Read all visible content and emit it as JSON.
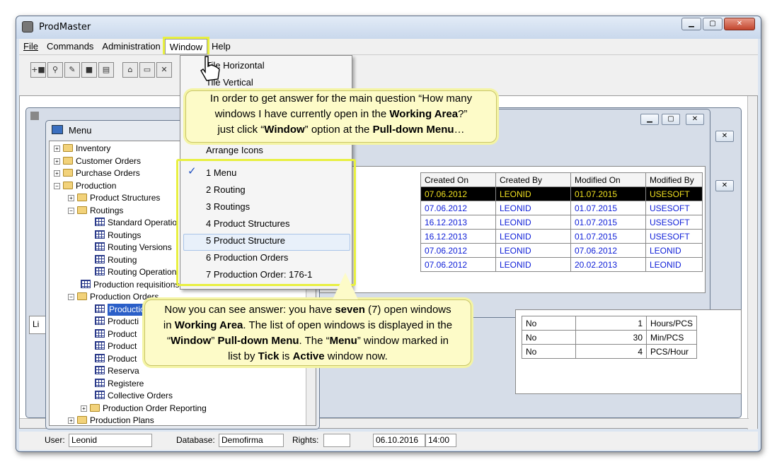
{
  "app": {
    "title": "ProdMaster"
  },
  "menubar": {
    "file": "File",
    "commands": "Commands",
    "administration": "Administration",
    "window": "Window",
    "help": "Help"
  },
  "window_menu": {
    "tile_horizontal": "Tile Horizontal",
    "tile_vertical": "Tile Vertical",
    "arrange_icons": "Arrange Icons",
    "windows": [
      "1 Menu",
      "2 Routing",
      "3 Routings",
      "4 Product Structures",
      "5 Product Structure",
      "6 Production Orders",
      "7 Production Order: 176-1"
    ],
    "active_index": 0,
    "check": "✓"
  },
  "menu_window": {
    "title": "Menu",
    "tree": [
      "Inventory",
      "Customer Orders",
      "Purchase Orders",
      "Production",
      "Product Structures",
      "Routings",
      "Standard Operatio",
      "Routings",
      "Routing Versions",
      "Routing",
      "Routing Operation",
      "Production requisitions",
      "Production Orders",
      "Production Orders List",
      "Producti",
      "Product",
      "Product",
      "Product",
      "Reserva",
      "Registere",
      "Collective Orders",
      "Production Order Reporting",
      "Production Plans"
    ]
  },
  "grid1": {
    "headers": [
      "Created On",
      "Created By",
      "Modified On",
      "Modified By"
    ],
    "rows": [
      [
        "07.06.2012",
        "LEONID",
        "01.07.2015",
        "USESOFT"
      ],
      [
        "07.06.2012",
        "LEONID",
        "01.07.2015",
        "USESOFT"
      ],
      [
        "16.12.2013",
        "LEONID",
        "01.07.2015",
        "USESOFT"
      ],
      [
        "16.12.2013",
        "LEONID",
        "01.07.2015",
        "USESOFT"
      ],
      [
        "07.06.2012",
        "LEONID",
        "07.06.2012",
        "LEONID"
      ],
      [
        "07.06.2012",
        "LEONID",
        "20.02.2013",
        "LEONID"
      ]
    ]
  },
  "grid2": {
    "rows": [
      [
        "No",
        "1",
        "Hours/PCS"
      ],
      [
        "No",
        "30",
        "Min/PCS"
      ],
      [
        "No",
        "4",
        "PCS/Hour"
      ]
    ]
  },
  "callout1": {
    "l1a": "In order to get answer for the main question “How many",
    "l2a": "windows I have currently open in the ",
    "l2b": "Working Area",
    "l2c": "?”",
    "l3a": "just click “",
    "l3b": "Window",
    "l3c": "” option at the ",
    "l3d": "Pull-down Menu",
    "l3e": "…"
  },
  "callout2": {
    "l1a": "Now you can see answer: you have ",
    "l1b": "seven",
    "l1c": " (7) open windows",
    "l2a": "in ",
    "l2b": "Working Area",
    "l2c": ".  The list of open windows is displayed in the",
    "l3a": "“",
    "l3b": "Window",
    "l3c": "” ",
    "l3d": "Pull-down Menu",
    "l3e": ".  The “",
    "l3f": "Menu",
    "l3g": "” window marked in",
    "l4a": "list by ",
    "l4b": "Tick",
    "l4c": " is ",
    "l4d": "Active",
    "l4e": " window now."
  },
  "status": {
    "user_label": "User:",
    "user": "Leonid",
    "db_label": "Database:",
    "db": "Demofirma",
    "rights_label": "Rights:",
    "date": "06.10.2016",
    "time": "14:00",
    "li": "Li"
  }
}
